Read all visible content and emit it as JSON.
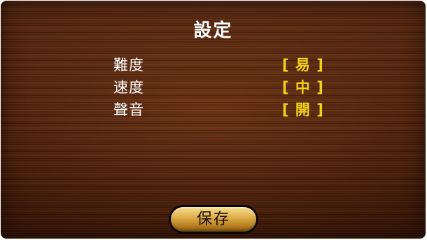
{
  "title": "設定",
  "settings": [
    {
      "label": "難度",
      "value": "[ 易 ]"
    },
    {
      "label": "速度",
      "value": "[ 中 ]"
    },
    {
      "label": "聲音",
      "value": "[ 開 ]"
    }
  ],
  "save_label": "保存",
  "colors": {
    "background": "#4a1f0b",
    "label_text": "#ffffff",
    "value_text": "#f2d21a",
    "button_gold": "#e2b04e"
  }
}
